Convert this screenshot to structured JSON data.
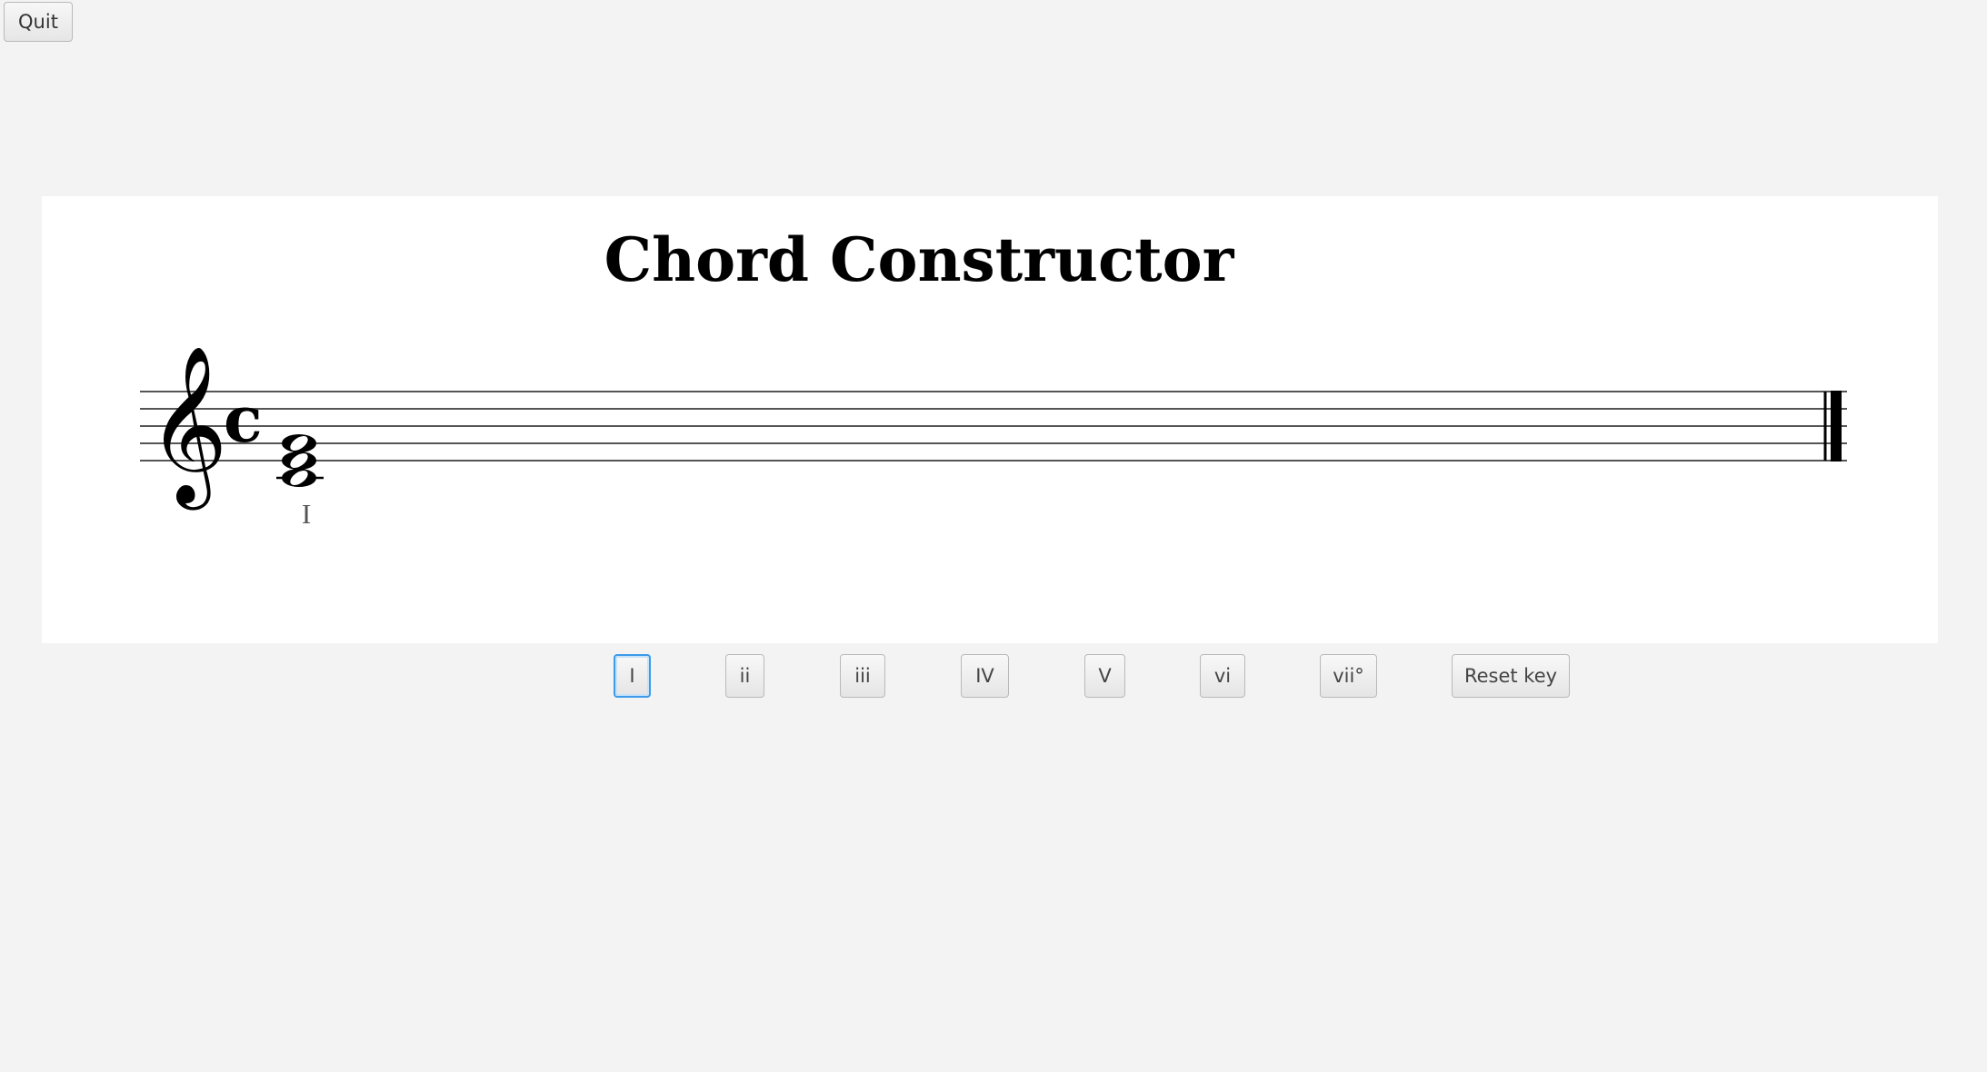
{
  "window": {
    "quit_label": "Quit"
  },
  "score": {
    "title": "Chord Constructor",
    "clef": "treble-clef",
    "time_signature": "c",
    "chord_label": "I"
  },
  "chord_buttons": [
    {
      "label": "I",
      "focused": true
    },
    {
      "label": "ii",
      "focused": false
    },
    {
      "label": "iii",
      "focused": false
    },
    {
      "label": "IV",
      "focused": false
    },
    {
      "label": "V",
      "focused": false
    },
    {
      "label": "vi",
      "focused": false
    },
    {
      "label": "vii°",
      "focused": false
    }
  ],
  "reset_label": "Reset key",
  "colors": {
    "background": "#f3f3f3",
    "panel": "#ffffff",
    "focus": "#3d9be9"
  }
}
